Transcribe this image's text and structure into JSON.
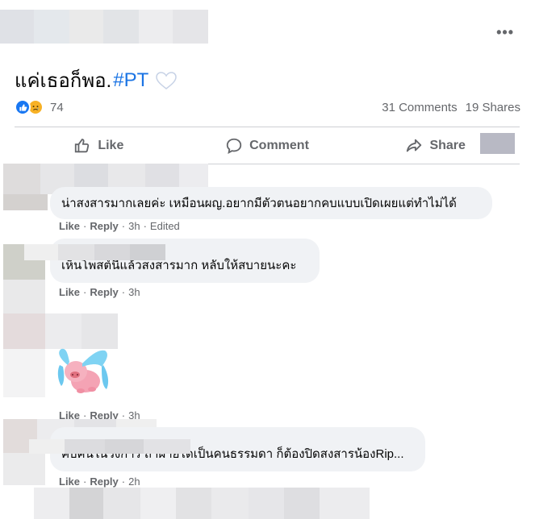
{
  "post": {
    "text": "แค่เธอก็พอ.",
    "hashtag": "#PT",
    "more_icon": "more-horizontal-icon",
    "reaction_count": "74",
    "comments_count": "31 Comments",
    "shares_count": "19 Shares",
    "colors": {
      "hashtag": "#1b74e4",
      "like_blue": "#1877f2",
      "sad_yellow": "#f7b125",
      "muted": "#65676b",
      "bubble": "#f0f2f5"
    }
  },
  "actions": {
    "like_label": "Like",
    "comment_label": "Comment",
    "share_label": "Share"
  },
  "comments": [
    {
      "text": "น่าสงสารมากเลยค่ะ เหมือนผญ.อยากมีตัวตนอยากคบแบบเปิดเผยแต่ทำไม่ได้",
      "like": "Like",
      "reply": "Reply",
      "time": "3h",
      "edited": "Edited"
    },
    {
      "text": "เห็นโพสต์นี้แล้วสงสารมาก หลับให้สบายนะคะ",
      "like": "Like",
      "reply": "Reply",
      "time": "3h"
    },
    {
      "sticker": "crying-pig-sticker",
      "like": "Like",
      "reply": "Reply",
      "time": "3h"
    },
    {
      "text": "คบคนในวงการ ถ้าฝ่ายไดเป็นคนธรรมดา ก็ต้องปิดสงสารน้องRip...",
      "like": "Like",
      "reply": "Reply",
      "time": "2h"
    }
  ],
  "separator": "·"
}
